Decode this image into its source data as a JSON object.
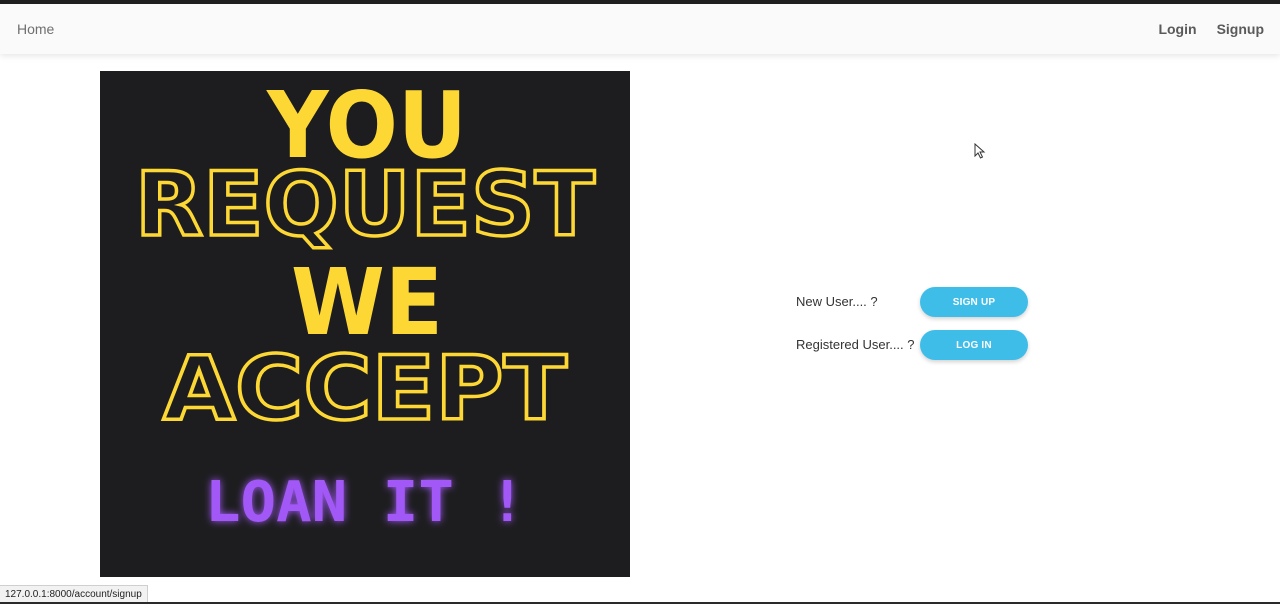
{
  "navbar": {
    "home_label": "Home",
    "login_label": "Login",
    "signup_label": "Signup"
  },
  "banner": {
    "line1": "YOU",
    "line2": "REQUEST",
    "line3": "WE",
    "line4": "ACCEPT",
    "line5": "LOAN IT !",
    "background_color": "#1d1d1f",
    "yellow_color": "#fdd835",
    "purple_color": "#a259f7"
  },
  "prompts": {
    "new_user_label": "New User.... ?",
    "signup_button_label": "SIGN UP",
    "registered_user_label": "Registered User.... ?",
    "login_button_label": "LOG IN"
  },
  "status_bar": {
    "url": "127.0.0.1:8000/account/signup"
  },
  "colors": {
    "button_accent": "#3fbde9"
  }
}
